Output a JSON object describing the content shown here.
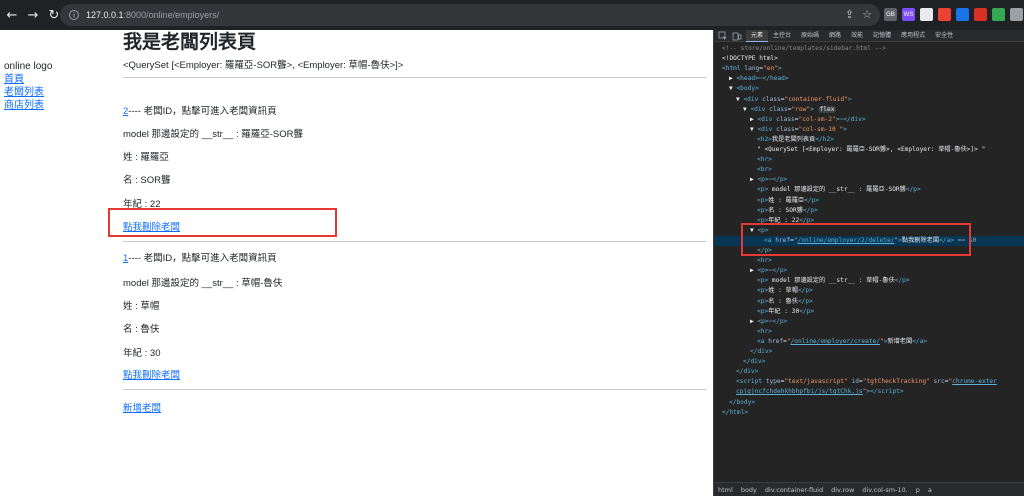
{
  "browser": {
    "url_host": "127.0.0.1",
    "url_path": ":8000/online/employers/",
    "extensions": [
      {
        "label": "GB",
        "color": "#5f6368"
      },
      {
        "label": "WS",
        "color": "#7c4dff"
      },
      {
        "label": "",
        "color": "#e8eaed"
      },
      {
        "label": "",
        "color": "#ea4335"
      },
      {
        "label": "",
        "color": "#1a73e8"
      },
      {
        "label": "",
        "color": "#d93025"
      },
      {
        "label": "",
        "color": "#34a853"
      },
      {
        "label": "",
        "color": "#9aa0a6"
      }
    ]
  },
  "sidebar": {
    "logo": "online logo",
    "links": [
      "首頁",
      "老闆列表",
      "商店列表"
    ]
  },
  "content": {
    "title": "我是老闆列表頁",
    "queryset": "<QuerySet [<Employer: 羅羅亞-SOR聾>, <Employer: 草帽-魯伕>]>",
    "employers": [
      {
        "id": "2",
        "id_suffix": "---- 老闆ID，點擊可進入老闆資訊頁",
        "model_str": "model 那邊設定的 __str__ : 羅羅亞-SOR聾",
        "last_name": "姓 : 羅羅亞",
        "first_name": "名 : SOR聾",
        "age": "年紀 : 22",
        "delete_link": "點我刪除老闆"
      },
      {
        "id": "1",
        "id_suffix": "---- 老闆ID，點擊可進入老闆資訊頁",
        "model_str": "model 那邊設定的 __str__ : 草帽-魯伕",
        "last_name": "姓 : 草帽",
        "first_name": "名 : 魯伕",
        "age": "年紀 : 30",
        "delete_link": "點我刪除老闆"
      }
    ],
    "create_link": "新增老闆"
  },
  "devtools": {
    "tabs": [
      "元素",
      "主控台",
      "原始碼",
      "網路",
      "效能",
      "記憶體",
      "應用程式",
      "安全性"
    ],
    "active_tab": "元素",
    "lines": [
      {
        "indent": 0,
        "html": "<span class='cmt'>&lt;!-- store/online/templates/sidebar.html --&gt;</span>"
      },
      {
        "indent": 0,
        "html": "<span class='txt'>&lt;!DOCTYPE html&gt;</span>"
      },
      {
        "indent": 0,
        "html": "<span class='tag'>&lt;html</span> <span class='attr'>lang</span>=<span class='val'>\"en\"</span><span class='tag'>&gt;</span>"
      },
      {
        "indent": 1,
        "html": "▶ <span class='tag'>&lt;head&gt;</span><span class='dots'>⋯</span><span class='tag'>&lt;/head&gt;</span>"
      },
      {
        "indent": 1,
        "html": "▼ <span class='tag'>&lt;body&gt;</span>"
      },
      {
        "indent": 2,
        "html": "▼ <span class='tag'>&lt;div</span> <span class='attr'>class</span>=<span class='val'>\"container-fluid\"</span><span class='tag'>&gt;</span>"
      },
      {
        "indent": 3,
        "html": "▼ <span class='tag'>&lt;div</span> <span class='attr'>class</span>=<span class='val'>\"row\"</span><span class='tag'>&gt;</span> <span class='badge'>flex</span>"
      },
      {
        "indent": 4,
        "html": "▶ <span class='tag'>&lt;div</span> <span class='attr'>class</span>=<span class='val'>\"col-sm-2\"</span><span class='tag'>&gt;</span><span class='dots'>⋯</span><span class='tag'>&lt;/div&gt;</span>"
      },
      {
        "indent": 4,
        "html": "▼ <span class='tag'>&lt;div</span> <span class='attr'>class</span>=<span class='val'>\"col-sm-10 \"</span><span class='tag'>&gt;</span>"
      },
      {
        "indent": 5,
        "html": "<span class='tag'>&lt;h2&gt;</span><span class='txt'>我是老闆列表頁</span><span class='tag'>&lt;/h2&gt;</span>"
      },
      {
        "indent": 5,
        "html": "<span class='txt'>\" &lt;QuerySet [&lt;Employer: 羅羅亞-SOR聾&gt;, &lt;Employer: 草帽-魯伕&gt;]&gt; \"</span>"
      },
      {
        "indent": 5,
        "html": "<span class='tag'>&lt;hr&gt;</span>"
      },
      {
        "indent": 5,
        "html": "<span class='tag'>&lt;br&gt;</span>"
      },
      {
        "indent": 4,
        "html": "▶ <span class='tag'>&lt;p&gt;</span><span class='dots'>⋯</span><span class='tag'>&lt;/p&gt;</span>"
      },
      {
        "indent": 5,
        "html": "<span class='tag'>&lt;p&gt;</span><span class='txt'> model 那邊設定的 __str__ : 羅羅亞-SOR聾</span><span class='tag'>&lt;/p&gt;</span>"
      },
      {
        "indent": 5,
        "html": "<span class='tag'>&lt;p&gt;</span><span class='txt'>姓 : 羅羅亞</span><span class='tag'>&lt;/p&gt;</span>"
      },
      {
        "indent": 5,
        "html": "<span class='tag'>&lt;p&gt;</span><span class='txt'>名 : SOR聾</span><span class='tag'>&lt;/p&gt;</span>"
      },
      {
        "indent": 5,
        "html": "<span class='tag'>&lt;p&gt;</span><span class='txt'>年紀 : 22</span><span class='tag'>&lt;/p&gt;</span>"
      },
      {
        "indent": 4,
        "html": "▼ <span class='tag'>&lt;p&gt;</span>"
      },
      {
        "indent": 6,
        "html": "<span class='tag'>&lt;a</span> <span class='attr'>href</span>=<span class='val'>\"</span><span class='link'>/online/employer/2/delete/</span><span class='val'>\"</span><span class='tag'>&gt;</span><span class='txt'>點我刪除老闆</span><span class='tag'>&lt;/a&gt;</span> <span class='dots'>== $0</span>",
        "selected": true
      },
      {
        "indent": 5,
        "html": "<span class='tag'>&lt;/p&gt;</span>"
      },
      {
        "indent": 5,
        "html": "<span class='tag'>&lt;hr&gt;</span>"
      },
      {
        "indent": 4,
        "html": "▶ <span class='tag'>&lt;p&gt;</span><span class='dots'>⋯</span><span class='tag'>&lt;/p&gt;</span>"
      },
      {
        "indent": 5,
        "html": "<span class='tag'>&lt;p&gt;</span><span class='txt'> model 那邊設定的 __str__ : 草帽-魯伕</span><span class='tag'>&lt;/p&gt;</span>"
      },
      {
        "indent": 5,
        "html": "<span class='tag'>&lt;p&gt;</span><span class='txt'>姓 : 草帽</span><span class='tag'>&lt;/p&gt;</span>"
      },
      {
        "indent": 5,
        "html": "<span class='tag'>&lt;p&gt;</span><span class='txt'>名 : 魯伕</span><span class='tag'>&lt;/p&gt;</span>"
      },
      {
        "indent": 5,
        "html": "<span class='tag'>&lt;p&gt;</span><span class='txt'>年紀 : 30</span><span class='tag'>&lt;/p&gt;</span>"
      },
      {
        "indent": 4,
        "html": "▶ <span class='tag'>&lt;p&gt;</span><span class='dots'>⋯</span><span class='tag'>&lt;/p&gt;</span>"
      },
      {
        "indent": 5,
        "html": "<span class='tag'>&lt;hr&gt;</span>"
      },
      {
        "indent": 5,
        "html": "<span class='tag'>&lt;a</span> <span class='attr'>href</span>=<span class='val'>\"</span><span class='link'>/online/employer/create/</span><span class='val'>\"</span><span class='tag'>&gt;</span><span class='txt'>新增老闆</span><span class='tag'>&lt;/a&gt;</span>"
      },
      {
        "indent": 4,
        "html": "<span class='tag'>&lt;/div&gt;</span>"
      },
      {
        "indent": 3,
        "html": "<span class='tag'>&lt;/div&gt;</span>"
      },
      {
        "indent": 2,
        "html": "<span class='tag'>&lt;/div&gt;</span>"
      },
      {
        "indent": 2,
        "html": "<span class='tag'>&lt;script</span> <span class='attr'>type</span>=<span class='val'>\"text/javascript\"</span> <span class='attr'>id</span>=<span class='val'>\"tgtCheckTracking\"</span> <span class='attr'>src</span>=<span class='val'>\"</span><span class='link'>chrome-exter</span>"
      },
      {
        "indent": 2,
        "html": "<span class='link'>cpjgjncfchdehkhbhpfbi/js/tgtChk.js</span><span class='val'>\"</span><span class='tag'>&gt;&lt;/script&gt;</span>"
      },
      {
        "indent": 1,
        "html": "<span class='tag'>&lt;/body&gt;</span>"
      },
      {
        "indent": 0,
        "html": "<span class='tag'>&lt;/html&gt;</span>"
      }
    ],
    "breadcrumbs": [
      "html",
      "body",
      "div.container-fluid",
      "div.row",
      "div.col-sm-10.",
      "p",
      "a"
    ]
  }
}
